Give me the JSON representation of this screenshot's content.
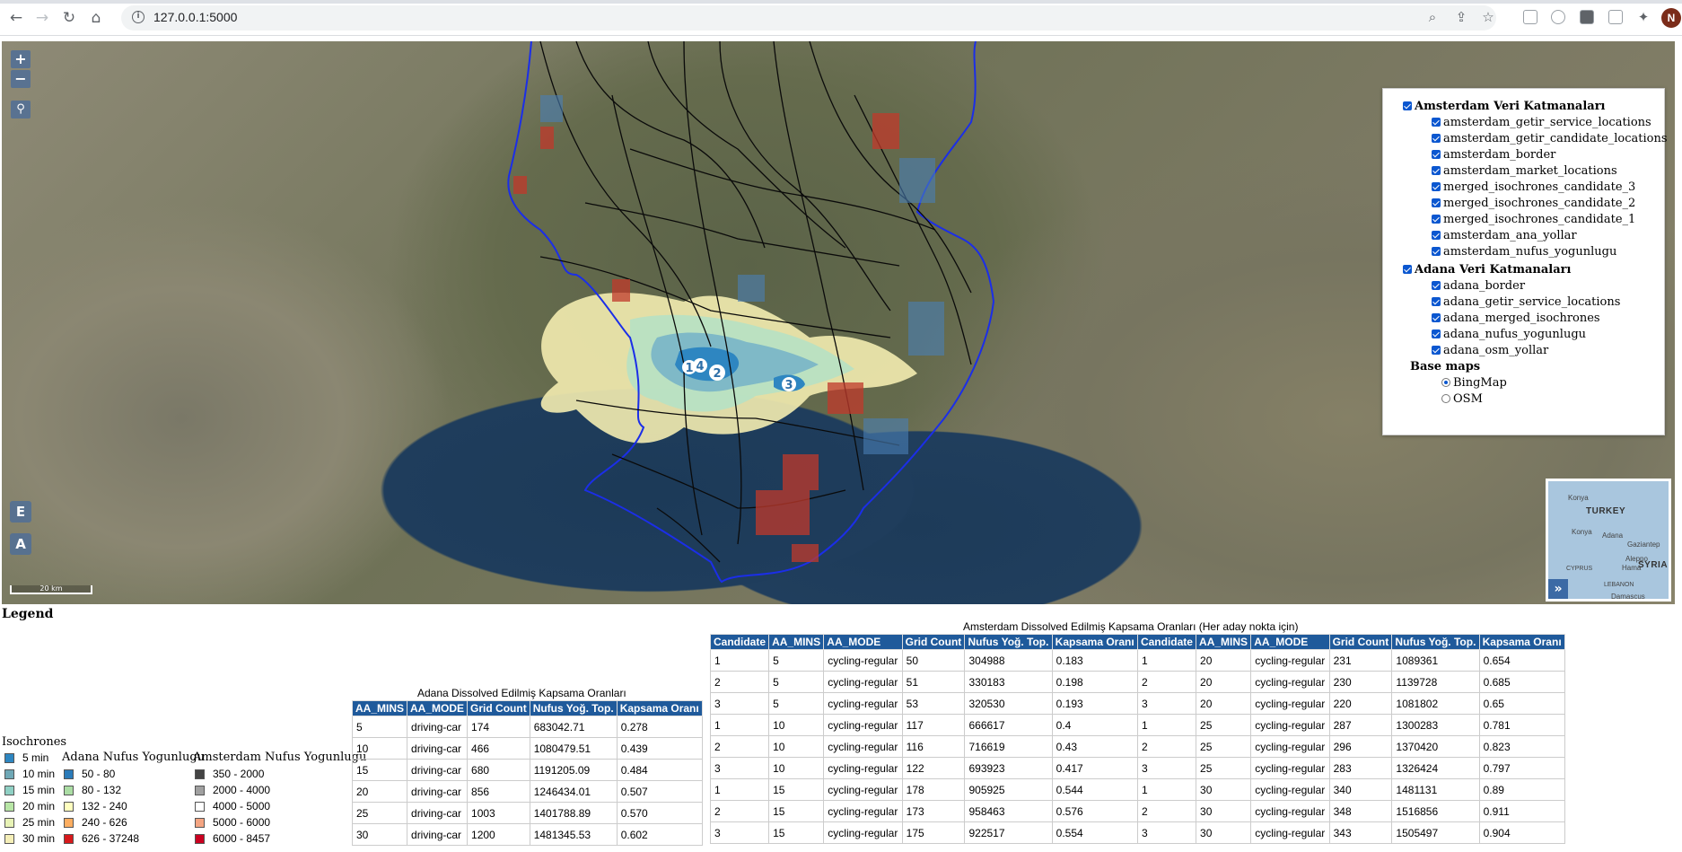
{
  "browser": {
    "url": "127.0.0.1:5000",
    "profile_initial": "N"
  },
  "map": {
    "zoom_in": "+",
    "zoom_out": "−",
    "btn_e": "E",
    "btn_a": "A",
    "scale": "20 km",
    "markers": [
      "1",
      "4",
      "2",
      "3"
    ],
    "overview": {
      "turkey": "TURKEY",
      "syria": "SYRIA",
      "konya": "Konya",
      "adana": "Adana",
      "gaziantep": "Gaziantep",
      "aleppo": "Aleppo",
      "hama": "Hama",
      "cyprus": "CYPRUS",
      "lebanon": "LEBANON",
      "damascus": "Damascus",
      "toggle": "»"
    }
  },
  "layers": {
    "amsterdam_group": "Amsterdam Veri Katmanaları",
    "amsterdam_items": [
      "amsterdam_getir_service_locations",
      "amsterdam_getir_candidate_locations",
      "amsterdam_border",
      "amsterdam_market_locations",
      "merged_isochrones_candidate_3",
      "merged_isochrones_candidate_2",
      "merged_isochrones_candidate_1",
      "amsterdam_ana_yollar",
      "amsterdam_nufus_yogunlugu"
    ],
    "adana_group": "Adana Veri Katmanaları",
    "adana_items": [
      "adana_border",
      "adana_getir_service_locations",
      "adana_merged_isochrones",
      "adana_nufus_yogunlugu",
      "adana_osm_yollar"
    ],
    "base_title": "Base maps",
    "base_items": [
      "BingMap",
      "OSM"
    ],
    "base_selected": "BingMap"
  },
  "legend": {
    "title": "Legend",
    "isochrones_title": "Isochrones",
    "adana_title": "Adana Nufus Yogunlugu",
    "amsterdam_title": "Amsterdam Nufus Yogunlugu",
    "isochrones": [
      {
        "label": "5 min",
        "color": "#2e86c1"
      },
      {
        "label": "10 min",
        "color": "#6fa8b6"
      },
      {
        "label": "15 min",
        "color": "#8fd0c4"
      },
      {
        "label": "20 min",
        "color": "#b8e6a6"
      },
      {
        "label": "25 min",
        "color": "#e8f3b6"
      },
      {
        "label": "30 min",
        "color": "#f5efb8"
      }
    ],
    "adana": [
      {
        "label": "50 - 80",
        "color": "#2b7bb9"
      },
      {
        "label": "80 - 132",
        "color": "#abdda4"
      },
      {
        "label": "132 - 240",
        "color": "#ffffbf"
      },
      {
        "label": "240 - 626",
        "color": "#fdae61"
      },
      {
        "label": "626 - 37248",
        "color": "#d7191c"
      }
    ],
    "amsterdam": [
      {
        "label": "350 - 2000",
        "color": "#444444"
      },
      {
        "label": "2000 - 4000",
        "color": "#a0a0a0"
      },
      {
        "label": "4000 - 5000",
        "color": "#ffffff"
      },
      {
        "label": "5000 - 6000",
        "color": "#f4a582"
      },
      {
        "label": "6000 - 8457",
        "color": "#ca0020"
      }
    ]
  },
  "adana_table": {
    "caption": "Adana Dissolved Edilmiş Kapsama Oranları",
    "headers": [
      "AA_MINS",
      "AA_MODE",
      "Grid Count",
      "Nufus Yoğ. Top.",
      "Kapsama Oranı"
    ],
    "rows": [
      [
        "5",
        "driving-car",
        "174",
        "683042.71",
        "0.278"
      ],
      [
        "10",
        "driving-car",
        "466",
        "1080479.51",
        "0.439"
      ],
      [
        "15",
        "driving-car",
        "680",
        "1191205.09",
        "0.484"
      ],
      [
        "20",
        "driving-car",
        "856",
        "1246434.01",
        "0.507"
      ],
      [
        "25",
        "driving-car",
        "1003",
        "1401788.89",
        "0.570"
      ],
      [
        "30",
        "driving-car",
        "1200",
        "1481345.53",
        "0.602"
      ]
    ]
  },
  "amsterdam_table": {
    "caption": "Amsterdam Dissolved Edilmiş Kapsama Oranları (Her aday nokta için)",
    "headers": [
      "Candidate",
      "AA_MINS",
      "AA_MODE",
      "Grid Count",
      "Nufus Yoğ. Top.",
      "Kapsama Oranı",
      "Candidate",
      "AA_MINS",
      "AA_MODE",
      "Grid Count",
      "Nufus Yoğ. Top.",
      "Kapsama Oranı"
    ],
    "rows": [
      [
        "1",
        "5",
        "cycling-regular",
        "50",
        "304988",
        "0.183",
        "1",
        "20",
        "cycling-regular",
        "231",
        "1089361",
        "0.654"
      ],
      [
        "2",
        "5",
        "cycling-regular",
        "51",
        "330183",
        "0.198",
        "2",
        "20",
        "cycling-regular",
        "230",
        "1139728",
        "0.685"
      ],
      [
        "3",
        "5",
        "cycling-regular",
        "53",
        "320530",
        "0.193",
        "3",
        "20",
        "cycling-regular",
        "220",
        "1081802",
        "0.65"
      ],
      [
        "1",
        "10",
        "cycling-regular",
        "117",
        "666617",
        "0.4",
        "1",
        "25",
        "cycling-regular",
        "287",
        "1300283",
        "0.781"
      ],
      [
        "2",
        "10",
        "cycling-regular",
        "116",
        "716619",
        "0.43",
        "2",
        "25",
        "cycling-regular",
        "296",
        "1370420",
        "0.823"
      ],
      [
        "3",
        "10",
        "cycling-regular",
        "122",
        "693923",
        "0.417",
        "3",
        "25",
        "cycling-regular",
        "283",
        "1326424",
        "0.797"
      ],
      [
        "1",
        "15",
        "cycling-regular",
        "178",
        "905925",
        "0.544",
        "1",
        "30",
        "cycling-regular",
        "340",
        "1481131",
        "0.89"
      ],
      [
        "2",
        "15",
        "cycling-regular",
        "173",
        "958463",
        "0.576",
        "2",
        "30",
        "cycling-regular",
        "348",
        "1516856",
        "0.911"
      ],
      [
        "3",
        "15",
        "cycling-regular",
        "175",
        "922517",
        "0.554",
        "3",
        "30",
        "cycling-regular",
        "343",
        "1505497",
        "0.904"
      ]
    ]
  }
}
